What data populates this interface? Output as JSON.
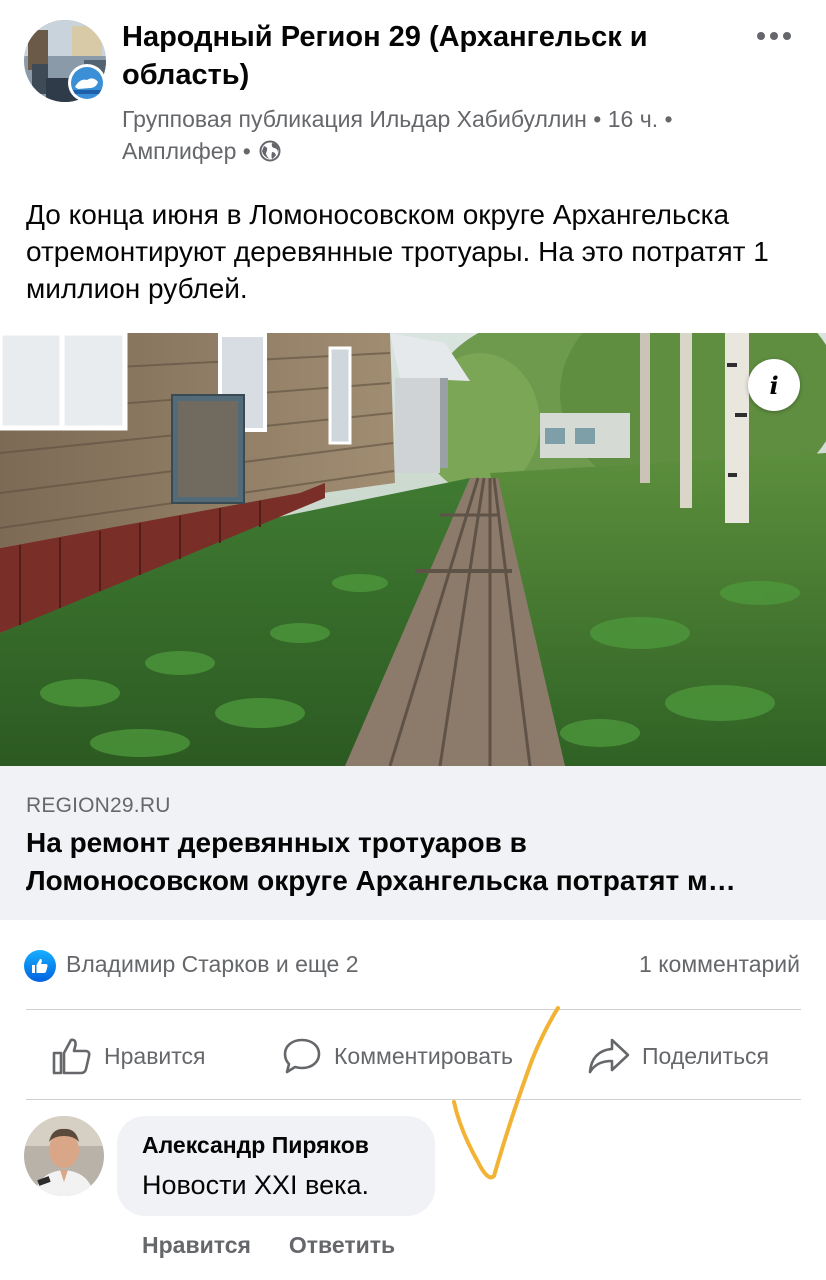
{
  "post": {
    "group_name": "Народный Регион 29 (Архангельск и область)",
    "meta_prefix": "Групповая публикация",
    "author": "Ильдар Хабибуллин",
    "time": "16 ч.",
    "app": "Амплифер",
    "separator": " • ",
    "more_icon": "more-horizontal-icon",
    "privacy_icon": "globe-icon",
    "text": "До конца июня в Ломоносовском округе Архангельска отремонтируют деревянные тротуары. На это потратят 1 миллион рублей."
  },
  "photo": {
    "subject": "wooden-boardwalk-photo",
    "info_label": "i"
  },
  "link": {
    "domain": "REGION29.RU",
    "title_line1": "На ремонт деревянных тротуаров в",
    "title_line2": "Ломоносовском округе Архангельска потратят м…"
  },
  "reactions": {
    "icon": "like-reaction-icon",
    "people": "Владимир Старков и еще 2",
    "comments": "1 комментарий"
  },
  "actions": {
    "like": "Нравится",
    "comment": "Комментировать",
    "share": "Поделиться"
  },
  "comment": {
    "author": "Александр Пиряков",
    "text": "Новости XXI века.",
    "like": "Нравится",
    "reply": "Ответить"
  },
  "colors": {
    "text_primary": "#050505",
    "text_secondary": "#65676b",
    "surface": "#f0f2f5",
    "like_blue": "#1877f2",
    "annotation_orange": "#f2b233"
  }
}
